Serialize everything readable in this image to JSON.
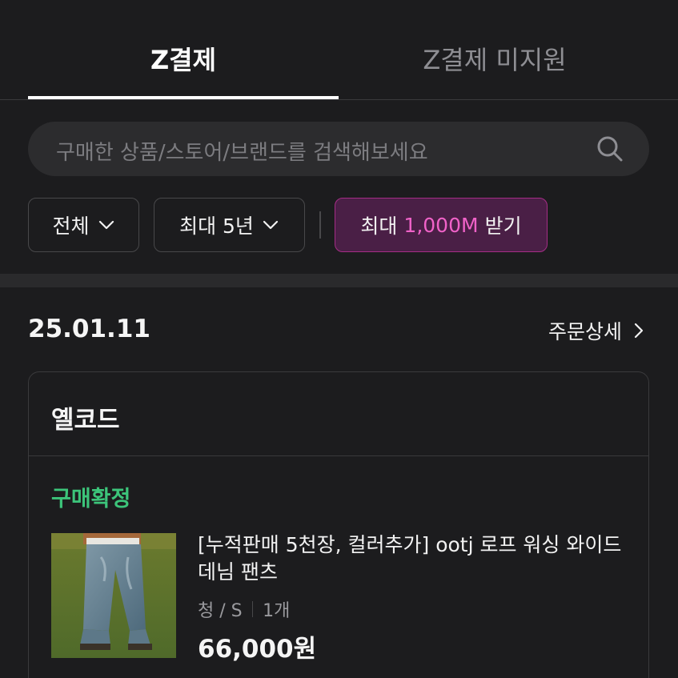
{
  "tabs": [
    {
      "label": "Z결제"
    },
    {
      "label": "Z결제 미지원"
    }
  ],
  "search": {
    "placeholder": "구매한 상품/스토어/브랜드를 검색해보세요"
  },
  "filters": {
    "all_label": "전체",
    "period_label": "최대 5년",
    "promo_prefix": "최대",
    "promo_amount": "1,000M",
    "promo_suffix": "받기"
  },
  "order": {
    "date": "25.01.11",
    "detail_label": "주문상세",
    "store": "옐코드",
    "status": "구매확정",
    "product": {
      "title": "[누적판매 5천장, 컬러추가] ootj 로프 워싱 와이드 데님 팬츠",
      "option": "청 / S",
      "quantity": "1개",
      "price": "66,000원"
    }
  },
  "colors": {
    "background": "#1c1c1e",
    "promo_accent": "#f062c8",
    "status_green": "#3cc47a"
  }
}
